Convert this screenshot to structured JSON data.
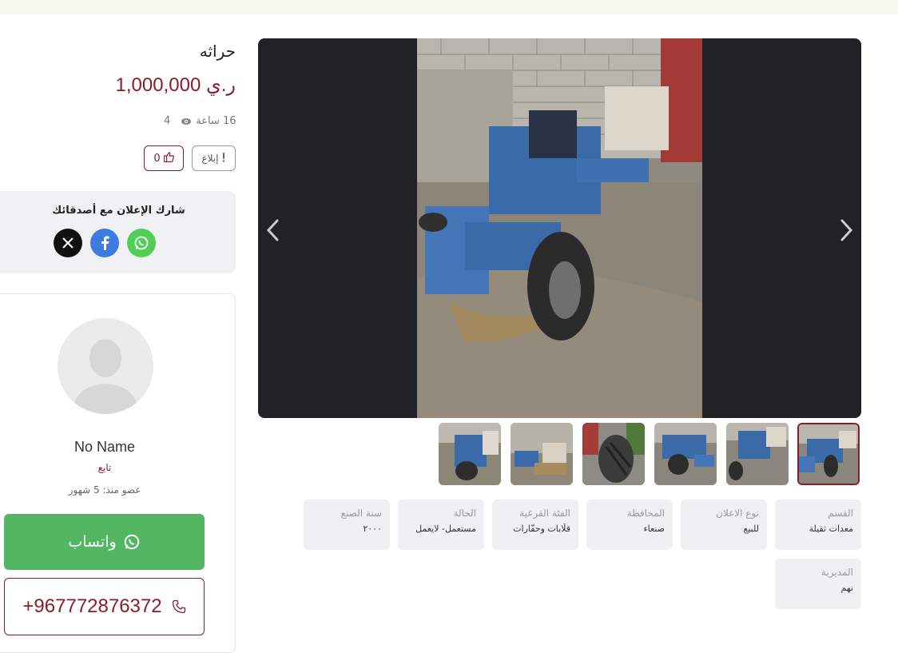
{
  "listing": {
    "title": "حراثه",
    "price": "1,000,000 ر.ي",
    "time_ago": "16 ساعة",
    "views": "4",
    "report_label": "إبلاغ",
    "likes": "0"
  },
  "share": {
    "title": "شارك الإعلان مع أصدقائك",
    "networks": [
      "x-icon",
      "facebook-icon",
      "whatsapp-icon"
    ]
  },
  "seller": {
    "name": "No Name",
    "follow_label": "تابع",
    "member_since": "عضو منذ: 5 شهور"
  },
  "contact": {
    "whatsapp_label": "واتساب",
    "phone": "+967772876372"
  },
  "attributes": [
    {
      "key": "القسم",
      "value": "معدات ثقيلة"
    },
    {
      "key": "نوع الاعلان",
      "value": "للبيع"
    },
    {
      "key": "المحافظة",
      "value": "صنعاء"
    },
    {
      "key": "الفئة الفرعية",
      "value": "قلّابات وحفّارات"
    },
    {
      "key": "الحالة",
      "value": "مستعمل- لايعمل"
    },
    {
      "key": "سنة الصنع",
      "value": "٢٠٠٠"
    },
    {
      "key": "المديرية",
      "value": "نهم"
    }
  ],
  "colors": {
    "accent": "#8a1c2b",
    "whatsapp": "#52b662",
    "gallery_bg": "#202226",
    "card_bg": "#eef0f1"
  },
  "gallery": {
    "thumbnail_count": 6,
    "active_thumbnail": 6
  }
}
